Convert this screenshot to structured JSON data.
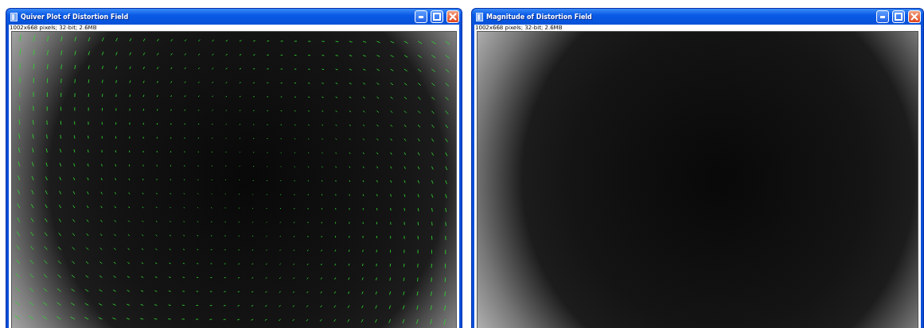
{
  "windows": [
    {
      "title": "Quiver Plot of Distortion Field",
      "info": "1002x668 pixels; 32-bit; 2.6MB",
      "kind": "quiver"
    },
    {
      "title": "Magnitude of Distortion Field",
      "info": "1002x668 pixels; 32-bit; 2.6MB",
      "kind": "magnitude"
    }
  ]
}
